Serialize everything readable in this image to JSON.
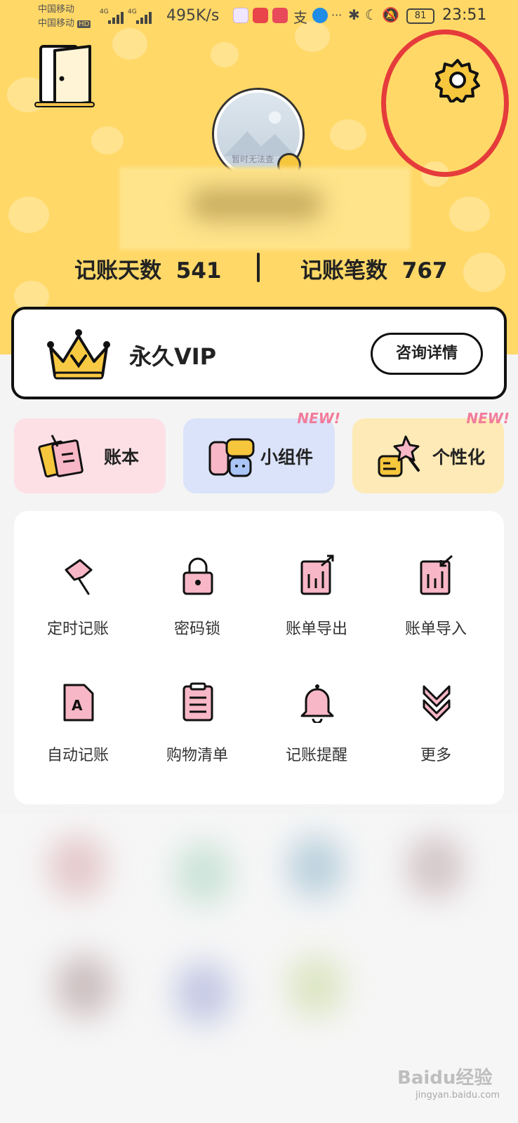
{
  "status_bar": {
    "carrier_1": "中国移动",
    "carrier_2": "中国移动",
    "hd": "HD",
    "signal_1": "4G",
    "signal_2": "4G",
    "net_speed": "495K/s",
    "battery": "81",
    "time": "23:51",
    "icons": [
      "bluetooth-icon",
      "moon-icon",
      "mute-icon"
    ]
  },
  "header": {
    "avatar_caption": "暂时无法查",
    "stats": {
      "days_label": "记账天数",
      "days_value": "541",
      "count_label": "记账笔数",
      "count_value": "767"
    }
  },
  "vip": {
    "title": "永久VIP",
    "button": "咨询详情"
  },
  "cards": [
    {
      "label": "账本",
      "new": "",
      "color": "#fde0e6"
    },
    {
      "label": "小组件",
      "new": "NEW!",
      "color": "#dbe3fa"
    },
    {
      "label": "个性化",
      "new": "NEW!",
      "color": "#fdeab6"
    }
  ],
  "tools": [
    {
      "label": "定时记账",
      "icon": "pin-icon"
    },
    {
      "label": "密码锁",
      "icon": "lock-icon"
    },
    {
      "label": "账单导出",
      "icon": "export-icon"
    },
    {
      "label": "账单导入",
      "icon": "import-icon"
    },
    {
      "label": "自动记账",
      "icon": "auto-doc-icon"
    },
    {
      "label": "购物清单",
      "icon": "clipboard-icon"
    },
    {
      "label": "记账提醒",
      "icon": "bell-icon"
    },
    {
      "label": "更多",
      "icon": "chevrons-down-icon"
    }
  ],
  "watermark": {
    "brand": "Baidu经验",
    "url": "jingyan.baidu.com"
  },
  "colors": {
    "header_bg": "#ffd867",
    "accent_pink": "#f6b6c4",
    "highlight_circle": "#e53b3b"
  }
}
